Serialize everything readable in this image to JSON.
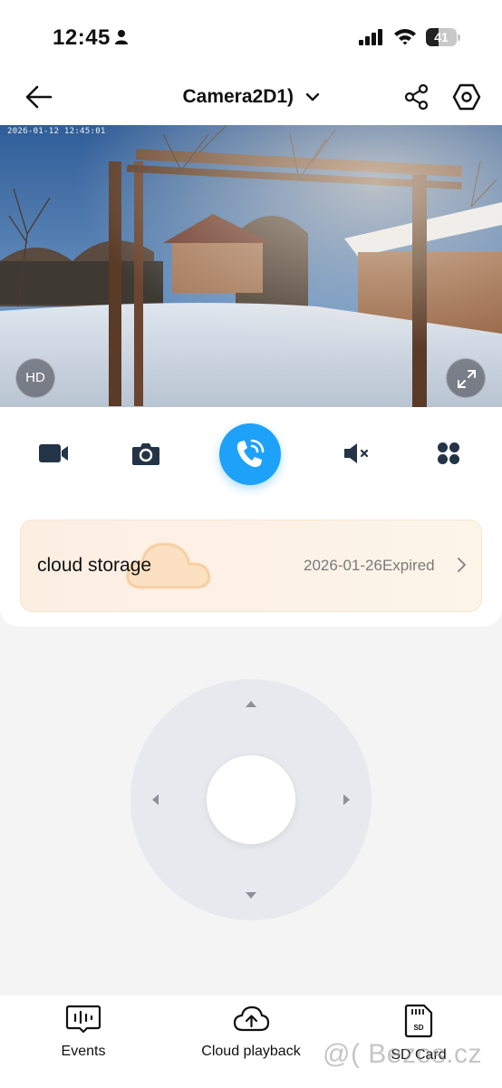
{
  "status_bar": {
    "time": "12:45",
    "battery_level": "41",
    "battery_fraction": 0.41
  },
  "header": {
    "title": "Camera2D1)",
    "icons": [
      "back-arrow-icon",
      "chevron-down-icon",
      "share-icon",
      "settings-icon"
    ]
  },
  "video": {
    "timestamp": "2026-01-12 12:45:01",
    "quality_label": "HD",
    "icons": [
      "fullscreen-icon"
    ]
  },
  "controls": {
    "icons": [
      "record-video-icon",
      "snapshot-icon",
      "talk-icon",
      "mute-icon",
      "more-icon"
    ],
    "accent_color": "#1da1f9"
  },
  "cloud_storage": {
    "label": "cloud storage",
    "status": "2026-01-26Expired"
  },
  "ptz": {
    "icons": [
      "ptz-up-arrow",
      "ptz-down-arrow",
      "ptz-left-arrow",
      "ptz-right-arrow"
    ]
  },
  "tabs": [
    {
      "label": "Events",
      "icon": "events-icon"
    },
    {
      "label": "Cloud playback",
      "icon": "cloud-upload-icon"
    },
    {
      "label": "SD Card",
      "icon": "sd-card-icon"
    }
  ],
  "watermark": "@( Bezos.cz"
}
